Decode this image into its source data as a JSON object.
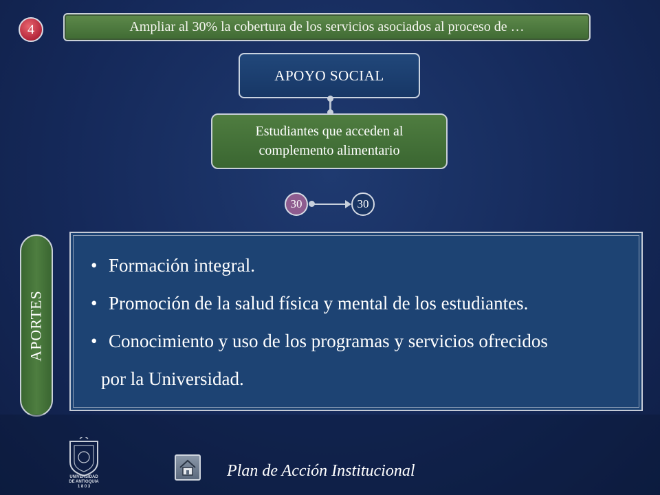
{
  "header": {
    "badge_number": "4",
    "banner_text": "Ampliar al 30% la cobertura de los servicios asociados al proceso de …"
  },
  "flow": {
    "program_title": "APOYO SOCIAL",
    "indicator_line1": "Estudiantes que acceden al",
    "indicator_line2": "complemento alimentario",
    "baseline_value": "30",
    "target_value": "30"
  },
  "aportes": {
    "tab_label": "APORTES",
    "bullet_mark": "•",
    "items": [
      "Formación integral.",
      "Promoción de la salud física y mental de los estudiantes.",
      "Conocimiento y uso de los programas y servicios ofrecidos"
    ],
    "continuation": "por la Universidad."
  },
  "footer": {
    "logo_line1": "UNIVERSIDAD",
    "logo_line2": "DE ANTIOQUIA",
    "logo_line3": "1 8 0 3",
    "title": "Plan de Acción Institucional",
    "home_icon": "home-icon"
  },
  "colors": {
    "background": "#15295a",
    "green_box": "#3f6a33",
    "blue_box": "#1d4373",
    "badge_red": "#b3263a",
    "start_circle": "#8e5c8f"
  }
}
